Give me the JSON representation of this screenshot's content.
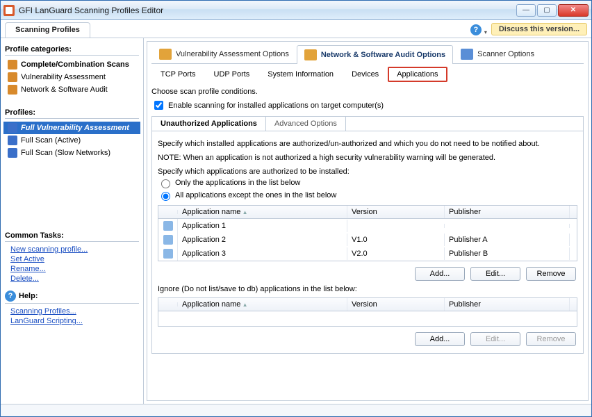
{
  "window": {
    "title": "GFI LanGuard Scanning Profiles Editor",
    "discuss": "Discuss this version..."
  },
  "top_tab": "Scanning Profiles",
  "sidebar": {
    "categories_heading": "Profile categories:",
    "categories": [
      {
        "label": "Complete/Combination Scans",
        "bold": true
      },
      {
        "label": "Vulnerability Assessment"
      },
      {
        "label": "Network & Software Audit"
      }
    ],
    "profiles_heading": "Profiles:",
    "profiles": [
      {
        "label": "Full Vulnerability Assessment",
        "selected": true,
        "bold": true,
        "italic": true
      },
      {
        "label": "Full Scan (Active)"
      },
      {
        "label": "Full Scan (Slow Networks)"
      }
    ],
    "tasks_heading": "Common Tasks:",
    "tasks": [
      "New scanning profile...",
      "Set Active",
      "Rename...",
      "Delete..."
    ],
    "help_heading": "Help:",
    "help_links": [
      "Scanning Profiles...",
      "LanGuard Scripting..."
    ]
  },
  "option_tabs": {
    "vuln": "Vulnerability Assessment Options",
    "net": "Network & Software Audit Options",
    "scan": "Scanner Options"
  },
  "sub_tabs": {
    "tcp": "TCP Ports",
    "udp": "UDP Ports",
    "sys": "System Information",
    "dev": "Devices",
    "apps": "Applications"
  },
  "conditions_label": "Choose scan profile conditions.",
  "enable_checkbox": "Enable scanning for installed applications on target computer(s)",
  "section_tabs": {
    "unauth": "Unauthorized Applications",
    "adv": "Advanced Options"
  },
  "panel": {
    "specify_text": "Specify which installed applications are authorized/un-authorized and which you do not need to be notified about.",
    "note_text": "NOTE: When an application is not authorized a high security vulnerability warning will be generated.",
    "radio_heading": "Specify which applications are authorized to be installed:",
    "radio_only": "Only the applications in the list below",
    "radio_except": "All applications except the ones in the list below",
    "columns": {
      "name": "Application name",
      "version": "Version",
      "publisher": "Publisher"
    },
    "apps": [
      {
        "name": "Application 1",
        "version": "",
        "publisher": ""
      },
      {
        "name": "Application 2",
        "version": "V1.0",
        "publisher": "Publisher A"
      },
      {
        "name": "Application 3",
        "version": "V2.0",
        "publisher": "Publisher B"
      }
    ],
    "ignore_heading": "Ignore (Do not list/save to db) applications in the list below:",
    "buttons": {
      "add": "Add...",
      "edit": "Edit...",
      "remove": "Remove"
    }
  }
}
